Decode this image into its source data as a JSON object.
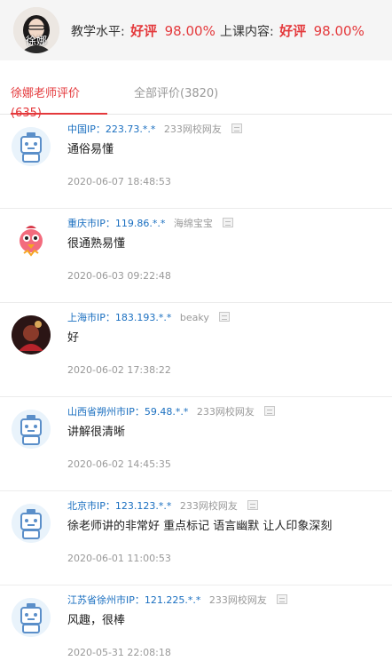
{
  "teacher": {
    "name": "徐娜",
    "stats": [
      {
        "label": "教学水平:",
        "rating": "好评",
        "percent": "98.00%"
      },
      {
        "label": "上课内容:",
        "rating": "好评",
        "percent": "98.00%"
      }
    ]
  },
  "tabs": [
    {
      "label": "徐娜老师评价",
      "count": "(635)"
    },
    {
      "label": "全部评价",
      "count": "(3820)"
    }
  ],
  "colors": {
    "accent": "#e4393c",
    "link": "#1a6fc0",
    "muted": "#999999"
  },
  "reviews": [
    {
      "avatar_icon": "robot-avatar-icon",
      "ip": "中国IP：223.73.*.*",
      "nickname": "233网校网友",
      "text": "通俗易懂",
      "time": "2020-06-07 18:48:53"
    },
    {
      "avatar_icon": "cartoon-bird-avatar-icon",
      "ip": "重庆市IP：119.86.*.*",
      "nickname": "海绵宝宝",
      "text": "很通熟易懂",
      "time": "2020-06-03 09:22:48"
    },
    {
      "avatar_icon": "photo-avatar-icon",
      "ip": "上海市IP：183.193.*.*",
      "nickname": "beaky",
      "text": "好",
      "time": "2020-06-02 17:38:22"
    },
    {
      "avatar_icon": "robot-avatar-icon",
      "ip": "山西省朔州市IP：59.48.*.*",
      "nickname": "233网校网友",
      "text": "讲解很清晰",
      "time": "2020-06-02 14:45:35"
    },
    {
      "avatar_icon": "robot-avatar-icon",
      "ip": "北京市IP：123.123.*.*",
      "nickname": "233网校网友",
      "text": "徐老师讲的非常好 重点标记 语言幽默 让人印象深刻",
      "time": "2020-06-01 11:00:53"
    },
    {
      "avatar_icon": "robot-avatar-icon",
      "ip": "江苏省徐州市IP：121.225.*.*",
      "nickname": "233网校网友",
      "text": "风趣，很棒",
      "time": "2020-05-31 22:08:18"
    }
  ]
}
